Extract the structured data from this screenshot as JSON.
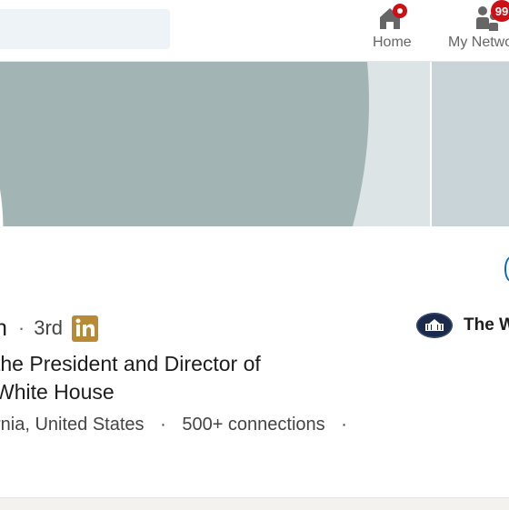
{
  "nav": {
    "search_placeholder": "",
    "items": [
      {
        "label": "Home",
        "icon": "home-icon",
        "badge": ""
      },
      {
        "label": "My Netwo",
        "icon": "people-icon",
        "badge": "99"
      }
    ]
  },
  "profile": {
    "name_fragment": "n",
    "degree": "3rd",
    "linkedin_badge": "in",
    "headline_line1": "the President and Director of",
    "headline_line2": "White House",
    "location": "rnia, United States",
    "connections": "500+ connections",
    "trailing_dot": "·"
  },
  "organization": {
    "name": "The W"
  },
  "colors": {
    "badge": "#cc1016",
    "linkedin_gold": "#b88a34",
    "banner_dark": "#a2b4b4",
    "banner_light": "#c8d4d8"
  }
}
